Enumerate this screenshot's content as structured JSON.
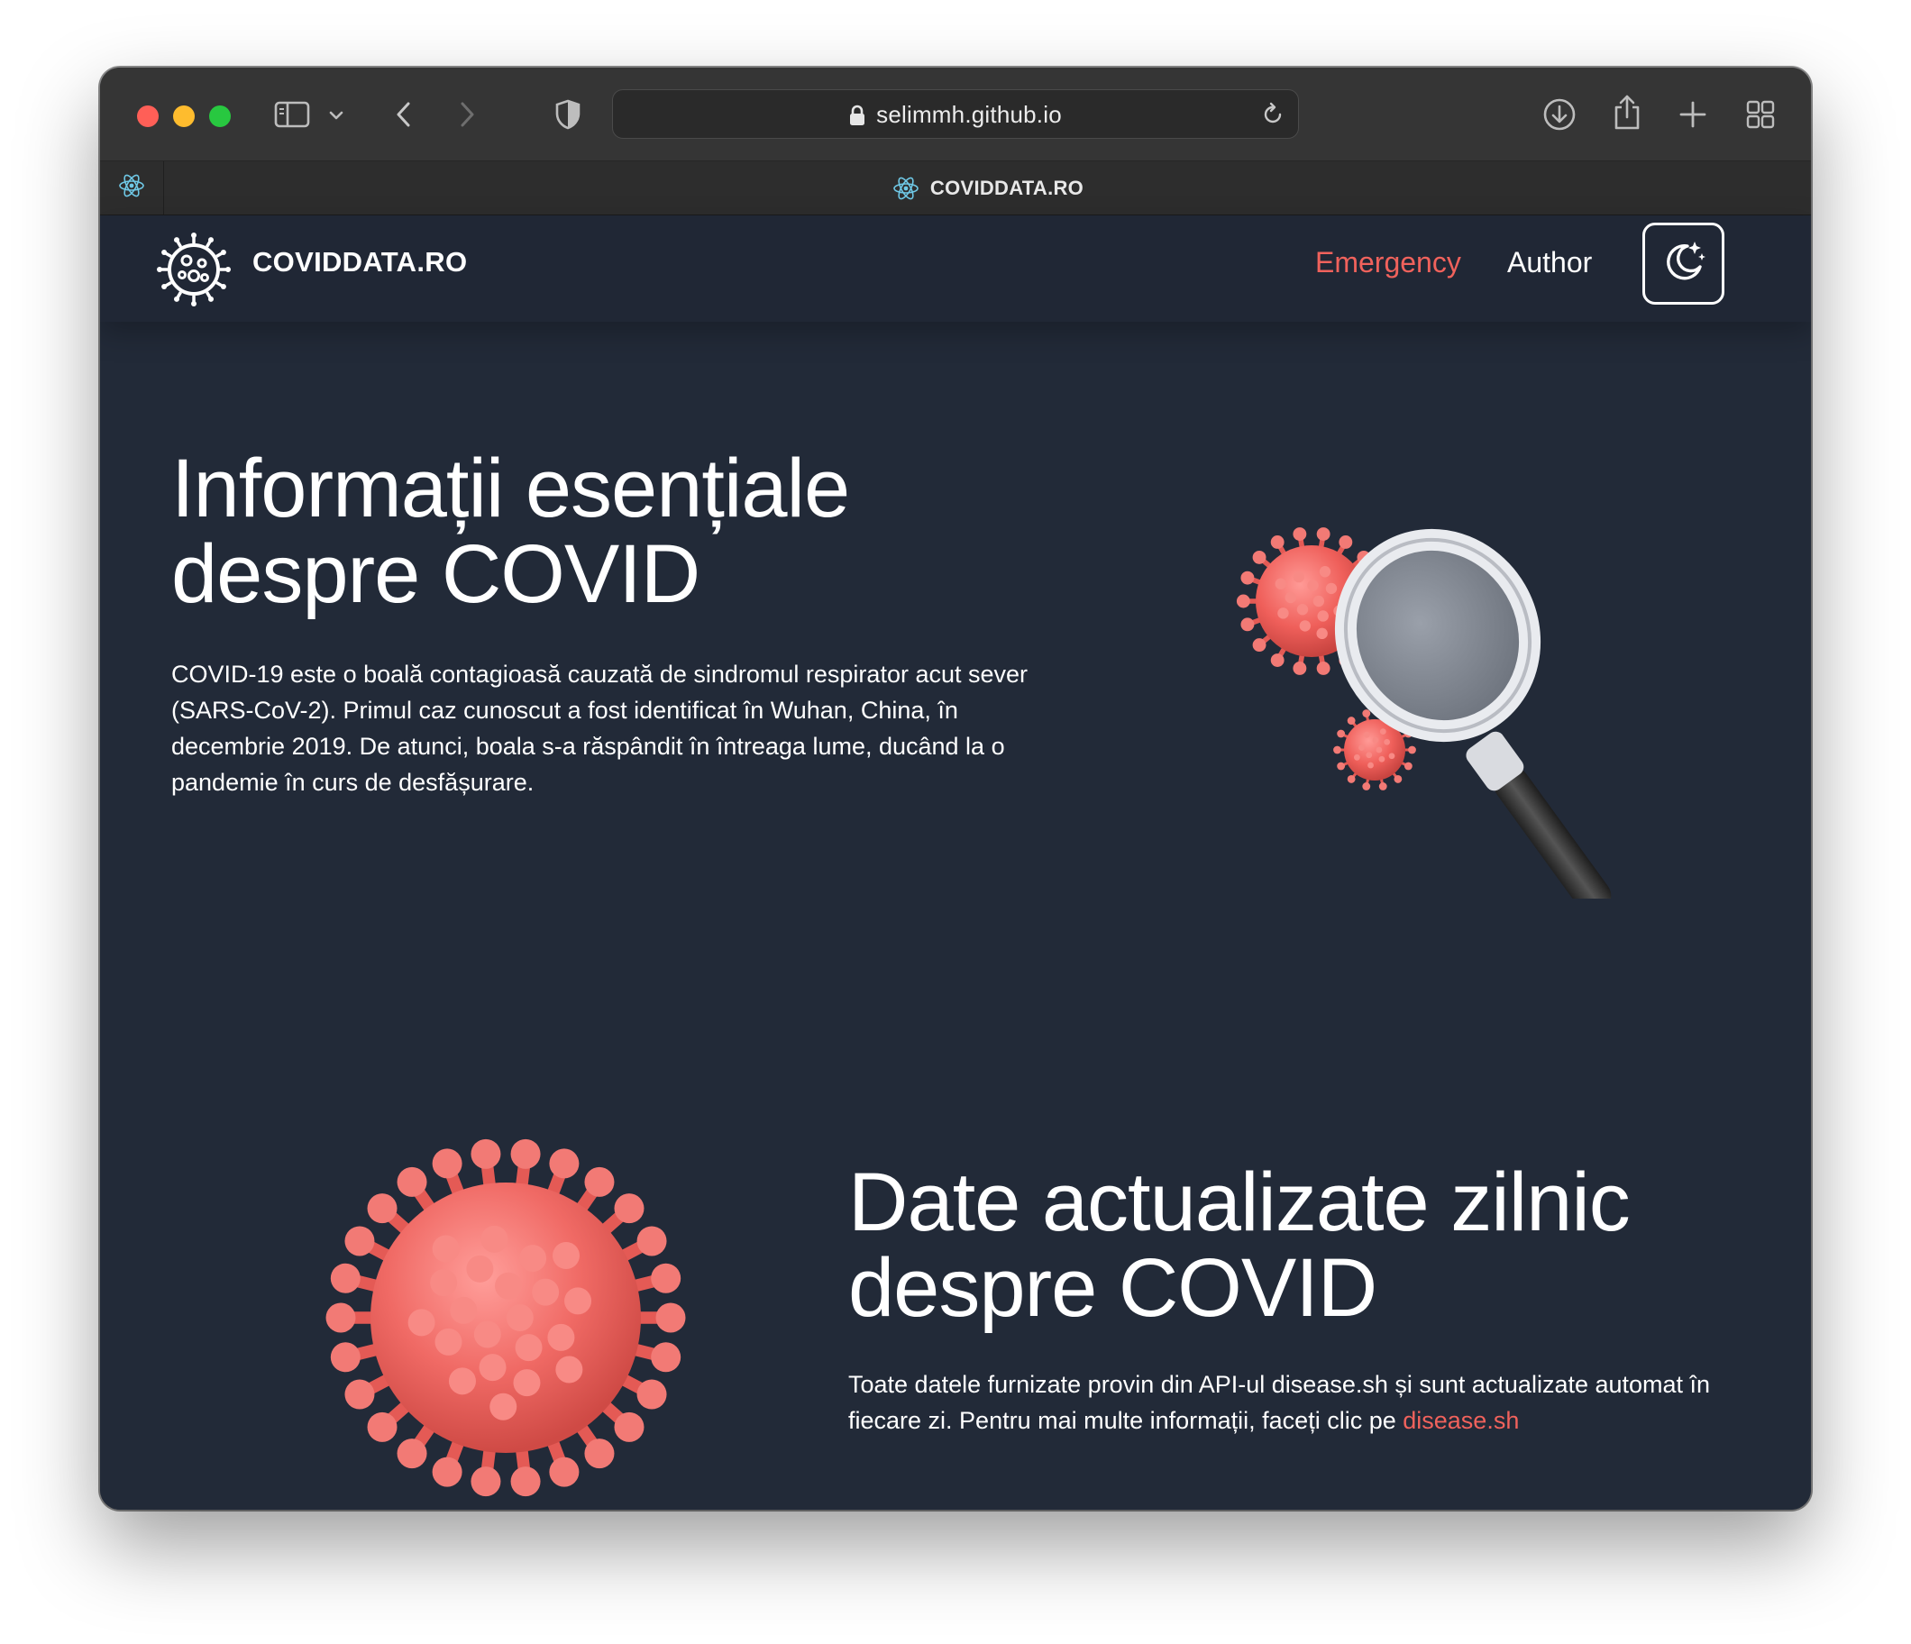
{
  "browser": {
    "url": "selimmh.github.io",
    "tab_title": "COVIDDATA.RO"
  },
  "nav": {
    "brand": "COVIDDATA.RO",
    "links": [
      "Emergency",
      "Author"
    ],
    "theme_toggle_icon": "moon-stars-icon"
  },
  "section1": {
    "title_line1": "Informații esențiale",
    "title_line2": "despre COVID",
    "paragraph": "COVID-19 este o boală contagioasă cauzată de sindromul respirator acut sever (SARS-CoV-2). Primul caz cunoscut a fost identificat în Wuhan, China, în decembrie 2019. De atunci, boala s-a răspândit în întreaga lume, ducând la o pandemie în curs de desfășurare."
  },
  "section2": {
    "title_line1": "Date actualizate zilnic",
    "title_line2": "despre COVID",
    "paragraph": "Toate datele furnizate provin din API-ul disease.sh și sunt actualizate automat în fiecare zi. Pentru mai multe informații, faceți clic pe",
    "link_text": "disease.sh"
  },
  "colors": {
    "page_background": "#222a38",
    "accent": "#f0625c",
    "text": "#ffffff"
  }
}
